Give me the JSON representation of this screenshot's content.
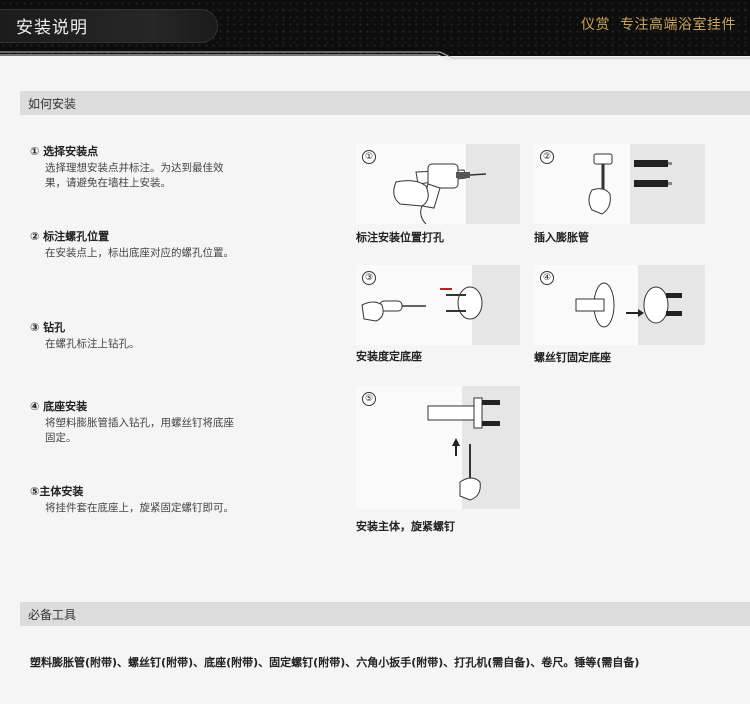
{
  "header": {
    "title": "安装说明",
    "brand": "仪赏",
    "slogan": "专注高端浴室挂件"
  },
  "section_install": {
    "label": "如何安装"
  },
  "steps": [
    {
      "title": "① 选择安装点",
      "desc": "选择理想安装点并标注。为达到最佳效果，请避免在墙柱上安装。"
    },
    {
      "title": "② 标注螺孔位置",
      "desc": "在安装点上，标出底座对应的螺孔位置。"
    },
    {
      "title": "③ 钻孔",
      "desc": "在螺孔标注上钻孔。"
    },
    {
      "title": "④ 底座安装",
      "desc": "将塑料膨胀管插入钻孔，用螺丝钉将底座固定。"
    },
    {
      "title": "⑤主体安装",
      "desc": "将挂件套在底座上，旋紧固定螺钉即可。"
    }
  ],
  "images": [
    {
      "num": "①",
      "caption": "标注安装位置打孔",
      "icon": "drill-icon"
    },
    {
      "num": "②",
      "caption": "插入膨胀管",
      "icon": "hammer-icon"
    },
    {
      "num": "③",
      "caption": "安装度定底座",
      "icon": "screwdriver-icon"
    },
    {
      "num": "④",
      "caption": "螺丝钉固定底座",
      "icon": "base-fix-icon"
    },
    {
      "num": "⑤",
      "caption": "安装主体，旋紧螺钉",
      "icon": "hex-key-icon"
    }
  ],
  "section_tools": {
    "label": "必备工具"
  },
  "tools_text": "塑料膨胀管(附带)、螺丝钉(附带)、底座(附带)、固定螺钉(附带)、六角小扳手(附带)、打孔机(需自备)、卷尺。锤等(需自备)",
  "colors": {
    "header_bg": "#0d0d0d",
    "brand_gold": "#c9a45c",
    "section_bar": "#dcdcdc"
  }
}
